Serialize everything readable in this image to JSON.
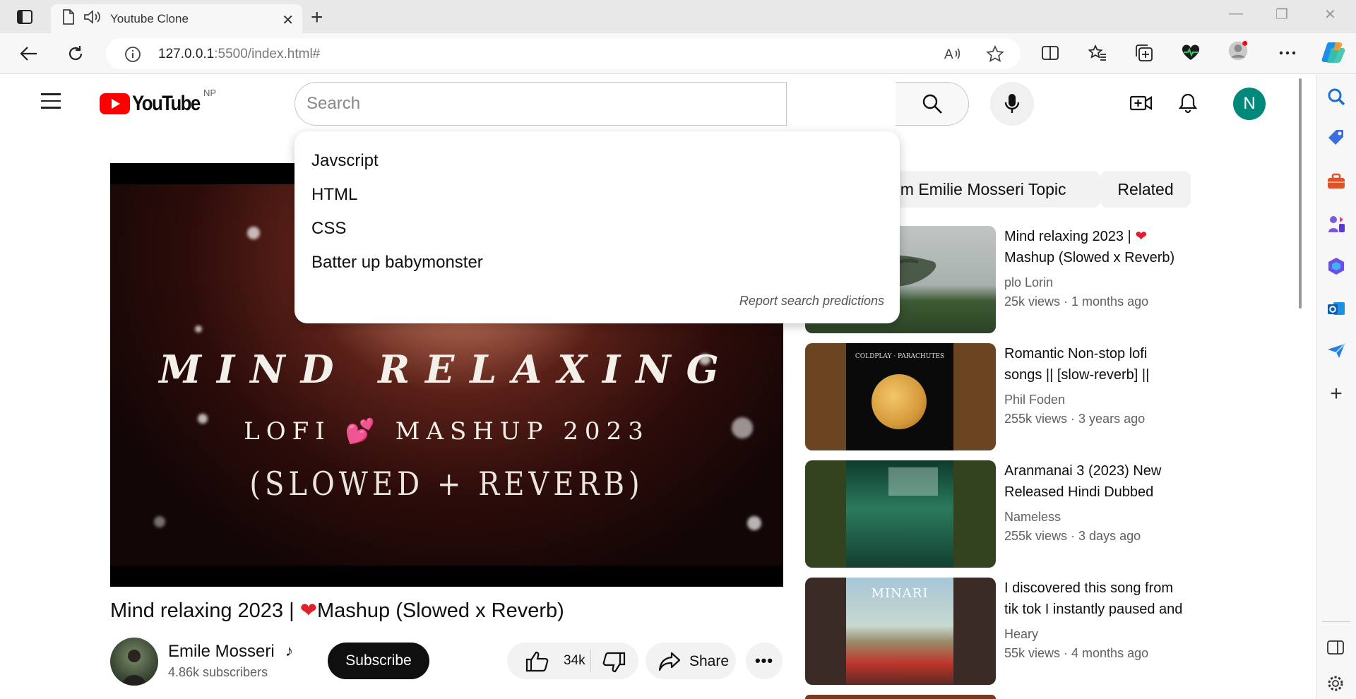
{
  "browser": {
    "tab_title": "Youtube Clone",
    "tab_close": "✕",
    "new_tab": "+",
    "url_host": "127.0.0.1",
    "url_path": ":5500/index.html#"
  },
  "header": {
    "logo_text": "YouTube",
    "region": "NP",
    "search_placeholder": "Search",
    "avatar_letter": "N"
  },
  "suggestions": {
    "items": [
      "Javscript",
      "HTML",
      "CSS",
      "Batter up babymonster"
    ],
    "report": "Report search predictions"
  },
  "video": {
    "art_line1": "MIND RELAXING",
    "art_line2a": "LOFI",
    "art_line2b": "MASHUP 2023",
    "art_line3": "(SLOWED + REVERB)",
    "title_a": "Mind relaxing 2023 |",
    "title_b": "Mashup (Slowed x Reverb)",
    "channel": "Emile Mosseri",
    "channel_note": "♪",
    "subscribers": "4.86k subscribers",
    "subscribe_label": "Subscribe",
    "likes": "34k",
    "share_label": "Share",
    "more_label": "•••"
  },
  "chips": [
    "om Emilie Mosseri Topic",
    "Related"
  ],
  "related": [
    {
      "title_a": "Mind relaxing 2023 |",
      "title_b": "Mashup (Slowed x Reverb)",
      "channel": "plo Lorin",
      "meta": "25k views · 1 months ago"
    },
    {
      "title_a": "Romantic Non-stop lofi",
      "title_b": "songs || [slow-reverb] ||",
      "channel": "Phil Foden",
      "meta": "255k views · 3 years ago",
      "cover_text": "COLDPLAY · PARACHUTES"
    },
    {
      "title_a": "Aranmanai 3 (2023) New",
      "title_b": "Released Hindi Dubbed",
      "channel": "Nameless",
      "meta": "255k views · 3 days ago"
    },
    {
      "title_a": "I discovered this song from",
      "title_b": "tik tok I instantly paused and",
      "channel": "Heary",
      "meta": "55k views · 4 months ago",
      "cover_text": "MINARI"
    }
  ],
  "colors": {
    "brand_red": "#ff0000",
    "avatar_bg": "#00897b",
    "heart": "#e0202e"
  }
}
